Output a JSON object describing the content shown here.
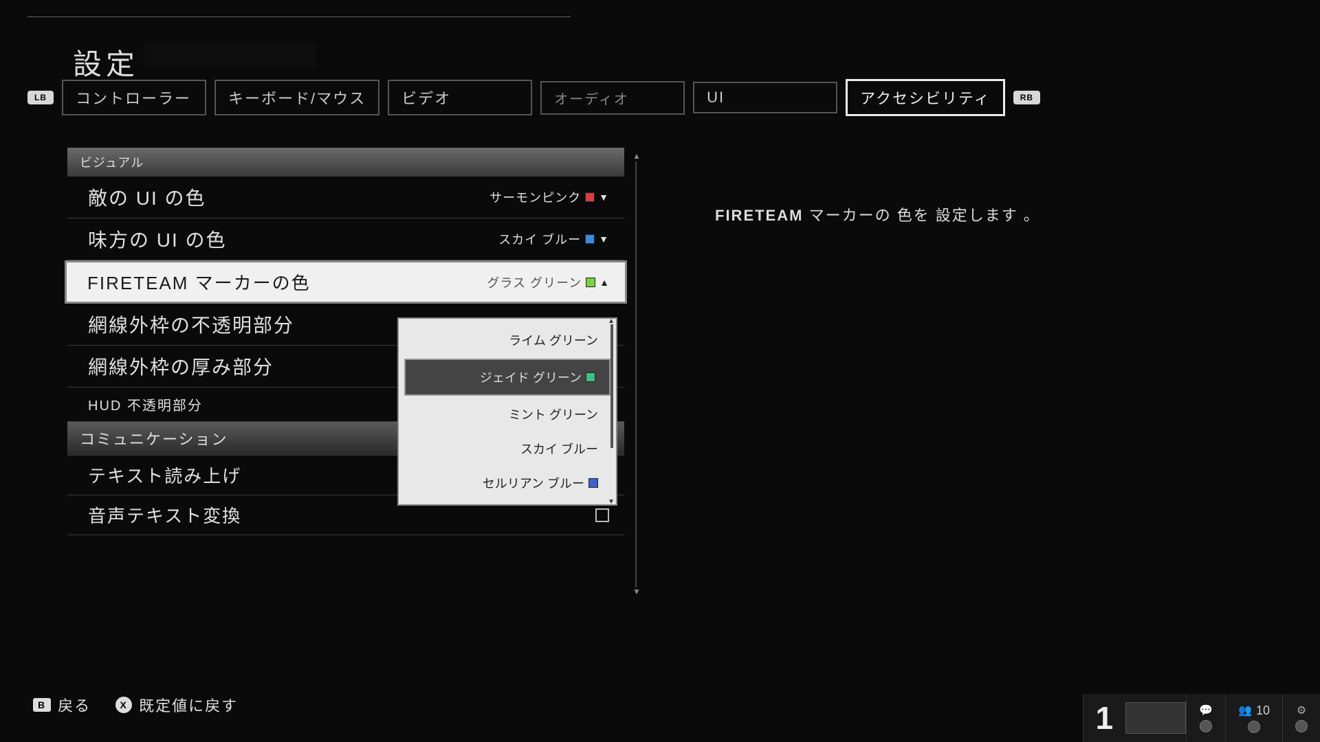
{
  "title": "設定",
  "bumpers": {
    "left": "LB",
    "right": "RB"
  },
  "tabs": [
    {
      "label": "コントローラー",
      "active": false
    },
    {
      "label": "キーボード/マウス",
      "active": false
    },
    {
      "label": "ビデオ",
      "active": false
    },
    {
      "label": "オーディオ",
      "active": false,
      "dim": true
    },
    {
      "label": "UI",
      "active": false
    },
    {
      "label": "アクセシビリティ",
      "active": true
    }
  ],
  "section1": "ビジュアル",
  "rows": {
    "enemy": {
      "label": "敵の UI の色",
      "value": "サーモンピンク",
      "color": "#d84040"
    },
    "ally": {
      "label": "味方の UI の色",
      "value": "スカイ ブルー",
      "color": "#3a8ae0"
    },
    "fireteam": {
      "label": "FIRETEAM マーカーの色",
      "value": "グラス グリーン",
      "color": "#7ad040"
    },
    "reticle_opacity": {
      "label": "網線外枠の不透明部分"
    },
    "reticle_thickness": {
      "label": "網線外枠の厚み部分"
    },
    "hud": {
      "label": "HUD 不透明部分"
    }
  },
  "section2": "コミュニケーション",
  "rows2": {
    "tts": {
      "label": "テキスト読み上げ"
    },
    "stt": {
      "label": "音声テキスト変換"
    }
  },
  "dropdown_options": [
    {
      "label": "ライム グリーン",
      "color": null
    },
    {
      "label": "ジェイド グリーン",
      "color": "#40c080",
      "hover": true
    },
    {
      "label": "ミント グリーン",
      "color": null
    },
    {
      "label": "スカイ ブルー",
      "color": null
    },
    {
      "label": "セルリアン ブルー",
      "color": "#4060d0"
    }
  ],
  "description": {
    "bold": "FIRETEAM",
    "rest": " マーカーの 色を 設定します 。"
  },
  "footer": {
    "back": {
      "key": "B",
      "label": "戻る"
    },
    "reset": {
      "key": "X",
      "label": "既定値に戻す"
    }
  },
  "status": {
    "num": "1",
    "players": "10"
  }
}
